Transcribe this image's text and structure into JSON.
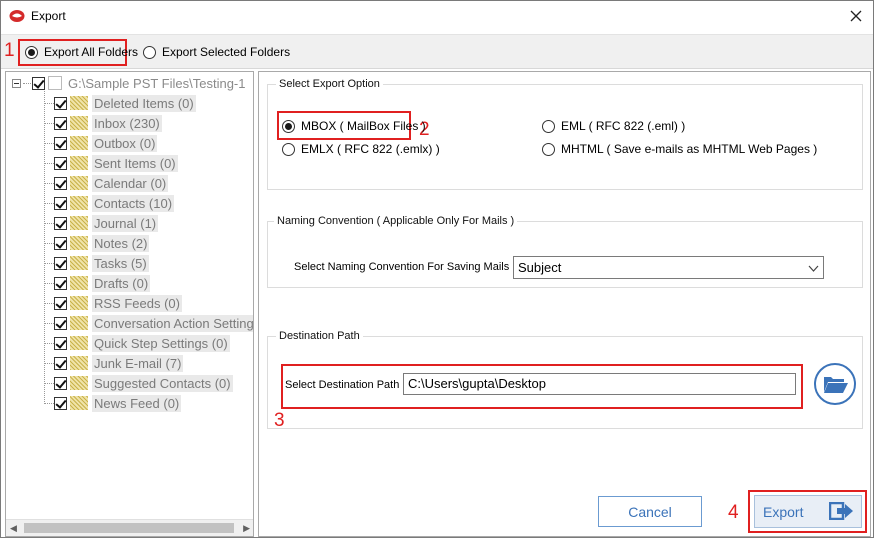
{
  "window": {
    "title": "Export"
  },
  "topbar": {
    "options": [
      {
        "label": "Export All Folders",
        "selected": true
      },
      {
        "label": "Export Selected Folders",
        "selected": false
      }
    ]
  },
  "annotations": [
    "1",
    "2",
    "3",
    "4"
  ],
  "tree": {
    "root_label": "G:\\Sample PST Files\\Testing-1",
    "items": [
      {
        "label": "Deleted Items (0)",
        "checked": true
      },
      {
        "label": "Inbox (230)",
        "checked": true
      },
      {
        "label": "Outbox (0)",
        "checked": true
      },
      {
        "label": "Sent Items (0)",
        "checked": true
      },
      {
        "label": "Calendar (0)",
        "checked": true
      },
      {
        "label": "Contacts (10)",
        "checked": true
      },
      {
        "label": "Journal (1)",
        "checked": true
      },
      {
        "label": "Notes (2)",
        "checked": true
      },
      {
        "label": "Tasks (5)",
        "checked": true
      },
      {
        "label": "Drafts (0)",
        "checked": true
      },
      {
        "label": "RSS Feeds (0)",
        "checked": true
      },
      {
        "label": "Conversation Action Setting",
        "checked": true
      },
      {
        "label": "Quick Step Settings (0)",
        "checked": true
      },
      {
        "label": "Junk E-mail (7)",
        "checked": true
      },
      {
        "label": "Suggested Contacts (0)",
        "checked": true
      },
      {
        "label": "News Feed (0)",
        "checked": true
      }
    ]
  },
  "export_option": {
    "title": "Select Export Option",
    "options": [
      {
        "label": "MBOX ( MailBox Files )",
        "selected": true
      },
      {
        "label": "EML ( RFC 822 (.eml) )",
        "selected": false
      },
      {
        "label": "EMLX ( RFC 822 (.emlx) )",
        "selected": false
      },
      {
        "label": "MHTML ( Save e-mails as MHTML Web Pages )",
        "selected": false
      }
    ]
  },
  "naming": {
    "title": "Naming Convention ( Applicable Only For Mails )",
    "label": "Select Naming Convention For Saving Mails",
    "value": "Subject"
  },
  "destination": {
    "title": "Destination Path",
    "label": "Select Destination Path",
    "value": "C:\\Users\\gupta\\Desktop"
  },
  "buttons": {
    "cancel": "Cancel",
    "export": "Export"
  },
  "colors": {
    "annotation_red": "#e02020",
    "accent_blue": "#3b73b9"
  }
}
